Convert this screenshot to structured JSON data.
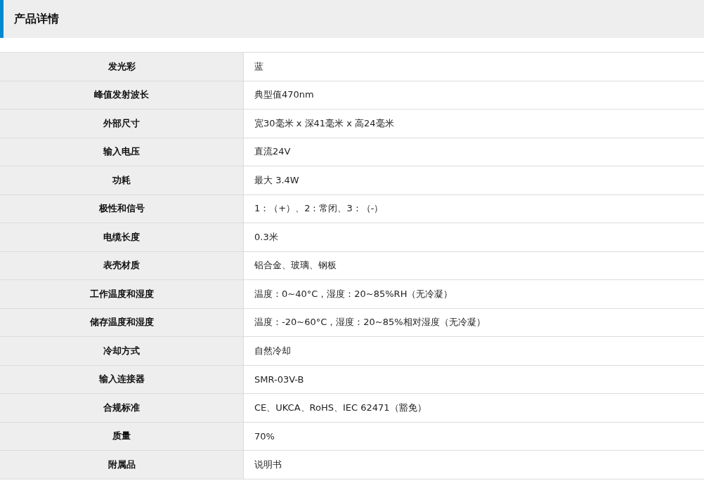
{
  "section": {
    "title": "产品详情"
  },
  "table": {
    "rows": [
      {
        "label": "发光彩",
        "value": "蓝"
      },
      {
        "label": "峰值发射波长",
        "value": "典型值470nm"
      },
      {
        "label": "外部尺寸",
        "value": "宽30毫米 x 深41毫米 x 高24毫米"
      },
      {
        "label": "输入电压",
        "value": "直流24V"
      },
      {
        "label": "功耗",
        "value": "最大 3.4W"
      },
      {
        "label": "极性和信号",
        "value": "1：（+）、2：常闭、3：（-）"
      },
      {
        "label": "电缆长度",
        "value": "0.3米"
      },
      {
        "label": "表壳材质",
        "value": "铝合金、玻璃、钢板"
      },
      {
        "label": "工作温度和湿度",
        "value": "温度：0~40°C，湿度：20~85%RH（无冷凝）"
      },
      {
        "label": "储存温度和湿度",
        "value": "温度：-20~60°C，湿度：20~85%相对湿度（无冷凝）"
      },
      {
        "label": "冷却方式",
        "value": "自然冷却"
      },
      {
        "label": "输入连接器",
        "value": "SMR-03V-B"
      },
      {
        "label": "合规标准",
        "value": "CE、UKCA、RoHS、IEC 62471（豁免）"
      },
      {
        "label": "质量",
        "value": "70%"
      },
      {
        "label": "附属品",
        "value": "说明书"
      }
    ]
  }
}
